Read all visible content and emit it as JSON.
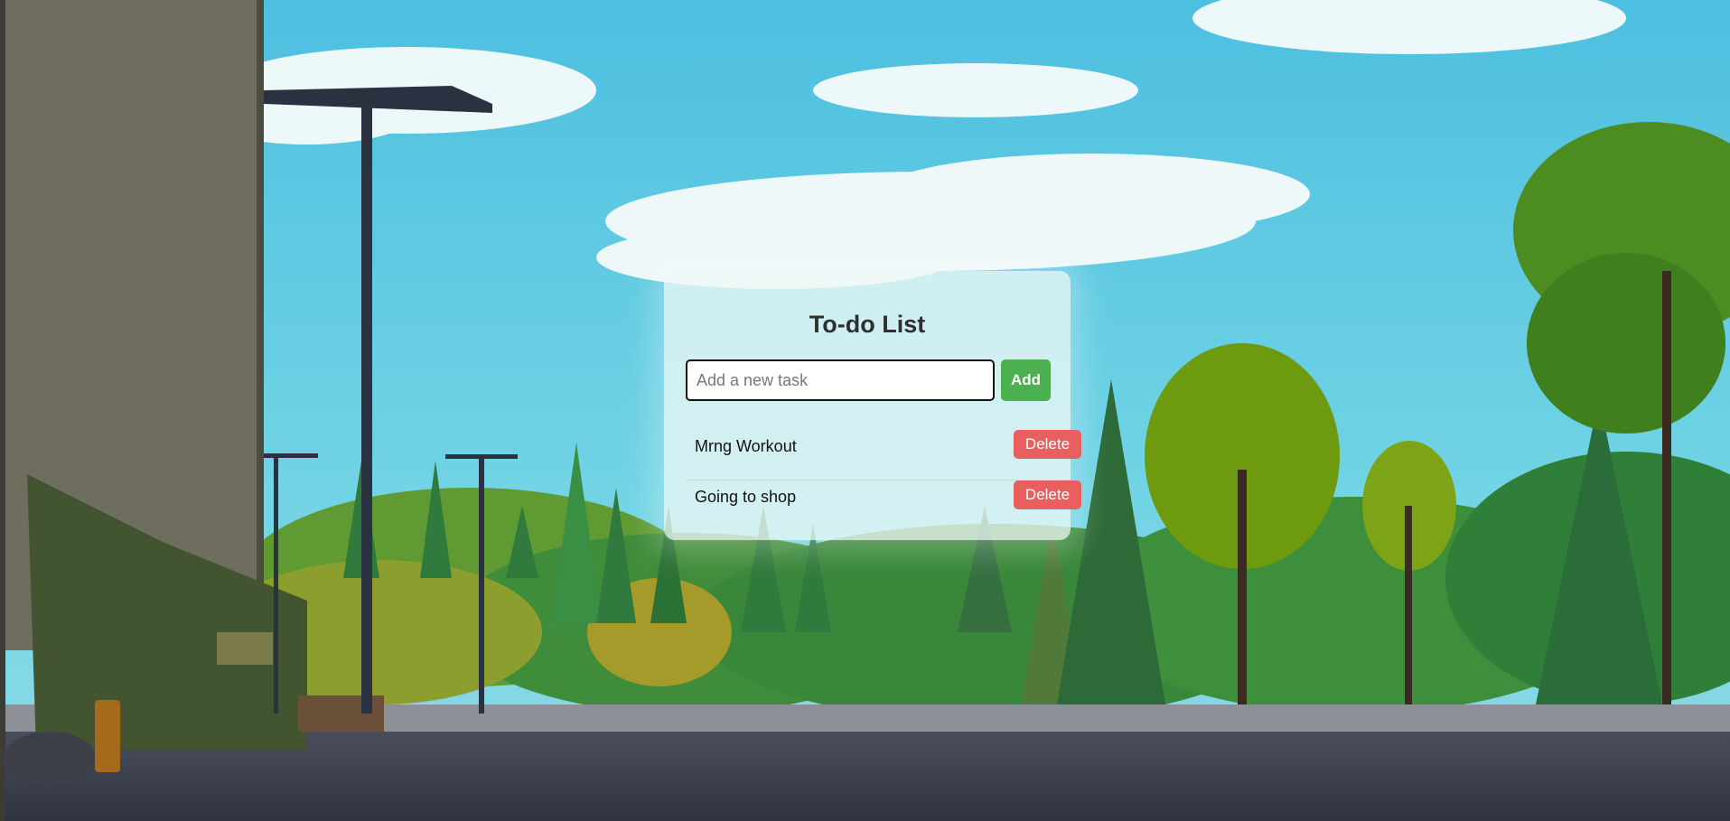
{
  "app": {
    "title": "To-do List"
  },
  "new_task": {
    "placeholder": "Add a new task",
    "value": "",
    "add_label": "Add"
  },
  "tasks": [
    {
      "text": "Mrng Workout",
      "delete_label": "Delete"
    },
    {
      "text": "Going to shop",
      "delete_label": "Delete"
    }
  ],
  "colors": {
    "add_button": "#4caf50",
    "delete_button": "#e95f5f",
    "sky": "#62cbe0",
    "trees": "#3f8f3a",
    "road": "#3d4354"
  }
}
